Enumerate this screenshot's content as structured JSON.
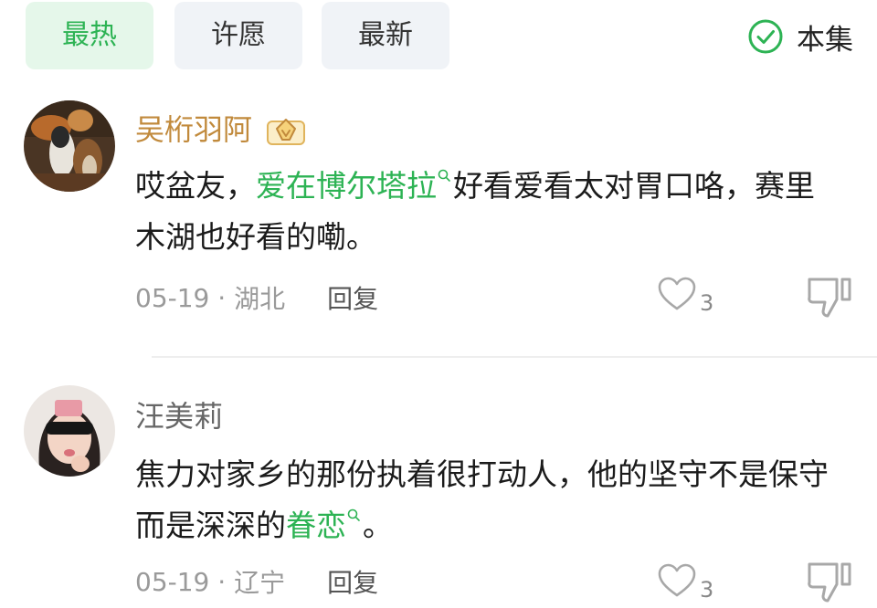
{
  "tabs": [
    {
      "label": "最热",
      "active": true
    },
    {
      "label": "许愿",
      "active": false
    },
    {
      "label": "最新",
      "active": false
    }
  ],
  "filter": {
    "label": "本集",
    "checked": true,
    "icon": "check-circle-icon"
  },
  "colors": {
    "accent_green": "#2db354",
    "vip_gold": "#c18a3c",
    "meta_gray": "#9a9a9a"
  },
  "comments": [
    {
      "username": "吴桁羽阿",
      "vip_badge_icon": "vip-crown-icon",
      "text": {
        "part1": "哎盆友，",
        "keyword": "爱在博尔塔拉",
        "part2": "好看爱看太对胃口咯，赛里木湖也好看的嘞。"
      },
      "date": "05-19",
      "location": "湖北",
      "reply_label": "回复",
      "likes": "3"
    },
    {
      "username": "汪美莉",
      "text": {
        "part1": "焦力对家乡的那份执着很打动人，他的坚守不是保守而是深深的",
        "keyword": "眷恋",
        "part2": "。"
      },
      "date": "05-19",
      "location": "辽宁",
      "reply_label": "回复",
      "likes": "3"
    }
  ]
}
